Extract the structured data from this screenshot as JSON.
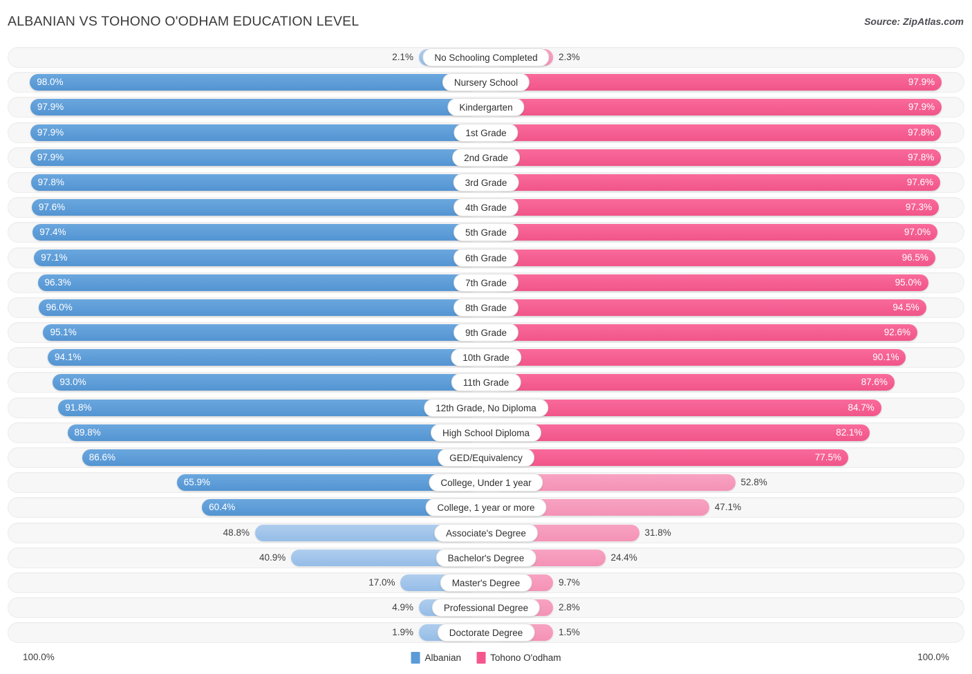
{
  "header": {
    "title": "ALBANIAN VS TOHONO O'ODHAM EDUCATION LEVEL",
    "source": "Source: ZipAtlas.com"
  },
  "footer": {
    "axis_left": "100.0%",
    "axis_right": "100.0%",
    "legend": [
      {
        "label": "Albanian",
        "color": "#5b9bd8"
      },
      {
        "label": "Tohono O'odham",
        "color": "#f4578e"
      }
    ]
  },
  "colors": {
    "blue_dark": "#5b9bd8",
    "blue_light": "#a0c4ea",
    "pink_dark": "#f4578e",
    "pink_light": "#f79ac0",
    "track": "#f7f7f7",
    "track_border": "#ededed"
  },
  "chart_data": {
    "type": "bar",
    "title": "ALBANIAN VS TOHONO O'ODHAM EDUCATION LEVEL",
    "subtitle": "Source: ZipAtlas.com",
    "orientation": "horizontal-diverging",
    "xlabel": "",
    "ylabel": "",
    "xlim": [
      0,
      100
    ],
    "unit": "%",
    "grid": false,
    "legend_position": "bottom-center",
    "categories": [
      "No Schooling Completed",
      "Nursery School",
      "Kindergarten",
      "1st Grade",
      "2nd Grade",
      "3rd Grade",
      "4th Grade",
      "5th Grade",
      "6th Grade",
      "7th Grade",
      "8th Grade",
      "9th Grade",
      "10th Grade",
      "11th Grade",
      "12th Grade, No Diploma",
      "High School Diploma",
      "GED/Equivalency",
      "College, Under 1 year",
      "College, 1 year or more",
      "Associate's Degree",
      "Bachelor's Degree",
      "Master's Degree",
      "Professional Degree",
      "Doctorate Degree"
    ],
    "series": [
      {
        "name": "Albanian",
        "color": "#5b9bd8",
        "values": [
          2.1,
          98.0,
          97.9,
          97.9,
          97.9,
          97.8,
          97.6,
          97.4,
          97.1,
          96.3,
          96.0,
          95.1,
          94.1,
          93.0,
          91.8,
          89.8,
          86.6,
          65.9,
          60.4,
          48.8,
          40.9,
          17.0,
          4.9,
          1.9
        ]
      },
      {
        "name": "Tohono O'odham",
        "color": "#f4578e",
        "values": [
          2.3,
          97.9,
          97.9,
          97.8,
          97.8,
          97.6,
          97.3,
          97.0,
          96.5,
          95.0,
          94.5,
          92.6,
          90.1,
          87.6,
          84.7,
          82.1,
          77.5,
          52.8,
          47.1,
          31.8,
          24.4,
          9.7,
          2.8,
          1.5
        ]
      }
    ]
  },
  "rows": [
    {
      "label": "No Schooling Completed",
      "left": "2.1%",
      "right": "2.3%",
      "left_v": 2.1,
      "right_v": 2.3
    },
    {
      "label": "Nursery School",
      "left": "98.0%",
      "right": "97.9%",
      "left_v": 98.0,
      "right_v": 97.9
    },
    {
      "label": "Kindergarten",
      "left": "97.9%",
      "right": "97.9%",
      "left_v": 97.9,
      "right_v": 97.9
    },
    {
      "label": "1st Grade",
      "left": "97.9%",
      "right": "97.8%",
      "left_v": 97.9,
      "right_v": 97.8
    },
    {
      "label": "2nd Grade",
      "left": "97.9%",
      "right": "97.8%",
      "left_v": 97.9,
      "right_v": 97.8
    },
    {
      "label": "3rd Grade",
      "left": "97.8%",
      "right": "97.6%",
      "left_v": 97.8,
      "right_v": 97.6
    },
    {
      "label": "4th Grade",
      "left": "97.6%",
      "right": "97.3%",
      "left_v": 97.6,
      "right_v": 97.3
    },
    {
      "label": "5th Grade",
      "left": "97.4%",
      "right": "97.0%",
      "left_v": 97.4,
      "right_v": 97.0
    },
    {
      "label": "6th Grade",
      "left": "97.1%",
      "right": "96.5%",
      "left_v": 97.1,
      "right_v": 96.5
    },
    {
      "label": "7th Grade",
      "left": "96.3%",
      "right": "95.0%",
      "left_v": 96.3,
      "right_v": 95.0
    },
    {
      "label": "8th Grade",
      "left": "96.0%",
      "right": "94.5%",
      "left_v": 96.0,
      "right_v": 94.5
    },
    {
      "label": "9th Grade",
      "left": "95.1%",
      "right": "92.6%",
      "left_v": 95.1,
      "right_v": 92.6
    },
    {
      "label": "10th Grade",
      "left": "94.1%",
      "right": "90.1%",
      "left_v": 94.1,
      "right_v": 90.1
    },
    {
      "label": "11th Grade",
      "left": "93.0%",
      "right": "87.6%",
      "left_v": 93.0,
      "right_v": 87.6
    },
    {
      "label": "12th Grade, No Diploma",
      "left": "91.8%",
      "right": "84.7%",
      "left_v": 91.8,
      "right_v": 84.7
    },
    {
      "label": "High School Diploma",
      "left": "89.8%",
      "right": "82.1%",
      "left_v": 89.8,
      "right_v": 82.1
    },
    {
      "label": "GED/Equivalency",
      "left": "86.6%",
      "right": "77.5%",
      "left_v": 86.6,
      "right_v": 77.5
    },
    {
      "label": "College, Under 1 year",
      "left": "65.9%",
      "right": "52.8%",
      "left_v": 65.9,
      "right_v": 52.8
    },
    {
      "label": "College, 1 year or more",
      "left": "60.4%",
      "right": "47.1%",
      "left_v": 60.4,
      "right_v": 47.1
    },
    {
      "label": "Associate's Degree",
      "left": "48.8%",
      "right": "31.8%",
      "left_v": 48.8,
      "right_v": 31.8
    },
    {
      "label": "Bachelor's Degree",
      "left": "40.9%",
      "right": "24.4%",
      "left_v": 40.9,
      "right_v": 24.4
    },
    {
      "label": "Master's Degree",
      "left": "17.0%",
      "right": "9.7%",
      "left_v": 17.0,
      "right_v": 9.7
    },
    {
      "label": "Professional Degree",
      "left": "4.9%",
      "right": "2.8%",
      "left_v": 4.9,
      "right_v": 2.8
    },
    {
      "label": "Doctorate Degree",
      "left": "1.9%",
      "right": "1.5%",
      "left_v": 1.9,
      "right_v": 1.5
    }
  ]
}
